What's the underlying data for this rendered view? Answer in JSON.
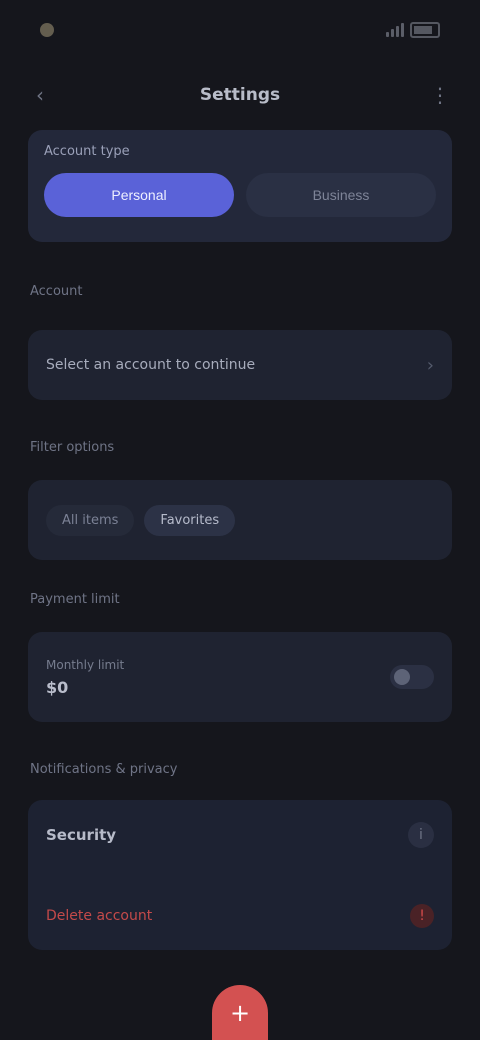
{
  "status_bar": {
    "time": "",
    "battery_label": ""
  },
  "nav": {
    "title": "Settings"
  },
  "hero": {
    "label": "Account type",
    "options": [
      {
        "label": "Personal",
        "active": true
      },
      {
        "label": "Business",
        "active": false
      }
    ]
  },
  "sections": {
    "account": {
      "label": "Account",
      "value": "Select an account to continue"
    },
    "filters": {
      "label": "Filter options",
      "pills": [
        "All items",
        "Favorites"
      ]
    },
    "payments": {
      "label": "Payment limit",
      "caption": "Monthly limit",
      "value": "$0"
    },
    "danger": {
      "label": "Notifications & privacy",
      "title": "Security",
      "link": "Delete account",
      "info_icon": "info-icon",
      "danger_icon": "warning-icon"
    }
  },
  "colors": {
    "accent": "#5a62d8",
    "danger": "#d35151",
    "background": "#15161c"
  }
}
